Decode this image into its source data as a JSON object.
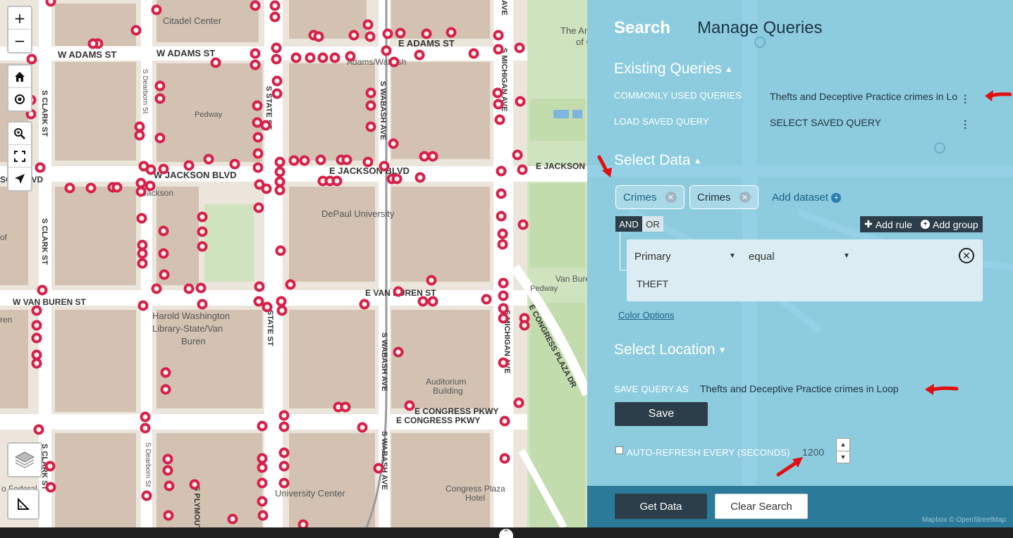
{
  "map": {
    "zoom_in": "+",
    "zoom_out": "−",
    "street_labels": {
      "w_adams_1": "W ADAMS ST",
      "w_adams_2": "W ADAMS ST",
      "e_adams": "E ADAMS ST",
      "w_jackson": "W JACKSON BLVD",
      "e_jackson": "E JACKSON BLVD",
      "jackson_left": "SON BLVD",
      "e_jackson_dr": "E JACKSON D",
      "w_van_buren": "W VAN BUREN ST",
      "e_van_buren": "E VAN BUREN ST",
      "e_congress_1": "E CONGRESS PKWY",
      "e_congress_2": "E CONGRESS PKWY",
      "e_congress_plaza": "E CONGRESS PLAZA DR",
      "s_clark_1": "S CLARK ST",
      "s_clark_2": "S CLARK ST",
      "s_clark_3": "S CLARK ST",
      "s_state_1": "S STATE ST",
      "s_state_2": "STATE ST",
      "s_wabash_1": "S WABASH AVE",
      "s_wabash_2": "S WABASH AVE",
      "s_wabash_3": "S WABASH AVE",
      "s_michigan_1": "S MICHIGAN AVE",
      "s_michigan_2": "S MICHIGAN AVE",
      "s_michigan_3": "AVE",
      "s_michigan_4": "S MICHIGAN AVE",
      "s_dearborn_1": "S Dearborn St",
      "s_dearborn_2": "S Dearborn St",
      "s_plymouth": "S PLYMOUT",
      "pedway_1": "Pedway",
      "pedway_2": "Pedway",
      "pedway_3": "Pedway"
    },
    "place_labels": {
      "citadel": "Citadel Center",
      "art_inst": "The Ar",
      "art_inst_2": "of Chicago",
      "adams_wabash": "Adams/Wabash",
      "depaul": "DePaul University",
      "harold_1": "Harold Washington",
      "harold_2": "Library-State/Van",
      "harold_3": "Buren",
      "auditorium_1": "Auditorium",
      "auditorium_2": "Building",
      "university_center": "University Center",
      "congress_plaza_1": "Congress Plaza",
      "congress_plaza_2": "Hotel",
      "jackson_stn": "Jackson",
      "van_buren_str": "Van Buren Stre",
      "of_label": "of",
      "ren_label": "ren",
      "federal": "o Federal"
    }
  },
  "panel": {
    "tabs": {
      "search": "Search",
      "manage": "Manage Queries"
    },
    "existing_queries": {
      "title": "Existing Queries",
      "chevron": "▲"
    },
    "commonly_used": {
      "label": "COMMONLY USED QUERIES",
      "value": "Thefts and Deceptive Practice crimes in Lo"
    },
    "load_saved": {
      "label": "LOAD SAVED QUERY",
      "value": "SELECT SAVED QUERY"
    },
    "select_data": {
      "title": "Select Data",
      "chevron": "▲"
    },
    "datasets": [
      "Crimes",
      "Crimes"
    ],
    "add_dataset": "Add dataset",
    "logic": {
      "and": "AND",
      "or": "OR"
    },
    "add_rule": "Add rule",
    "add_group": "Add group",
    "rule": {
      "field": "Primary",
      "operator": "equal",
      "value": "THEFT"
    },
    "color_options": "Color Options",
    "select_location": {
      "title": "Select Location",
      "chevron": "▼"
    },
    "save_query": {
      "label": "SAVE QUERY AS",
      "value": "Thefts and Deceptive Practice crimes in Loop"
    },
    "save": "Save",
    "auto_refresh": {
      "label": "AUTO-REFRESH EVERY (SECONDS)",
      "value": "1200",
      "checked": false
    },
    "get_data": "Get Data",
    "clear_search": "Clear Search",
    "attribution": "Mapbox © OpenStreetMap"
  },
  "colors": {
    "panel_bg": "#77c4df",
    "dark_button": "#2c3e49",
    "footer_bg": "#2b7a99",
    "marker": "#d6204a",
    "annotation_arrow": "#e01010"
  }
}
